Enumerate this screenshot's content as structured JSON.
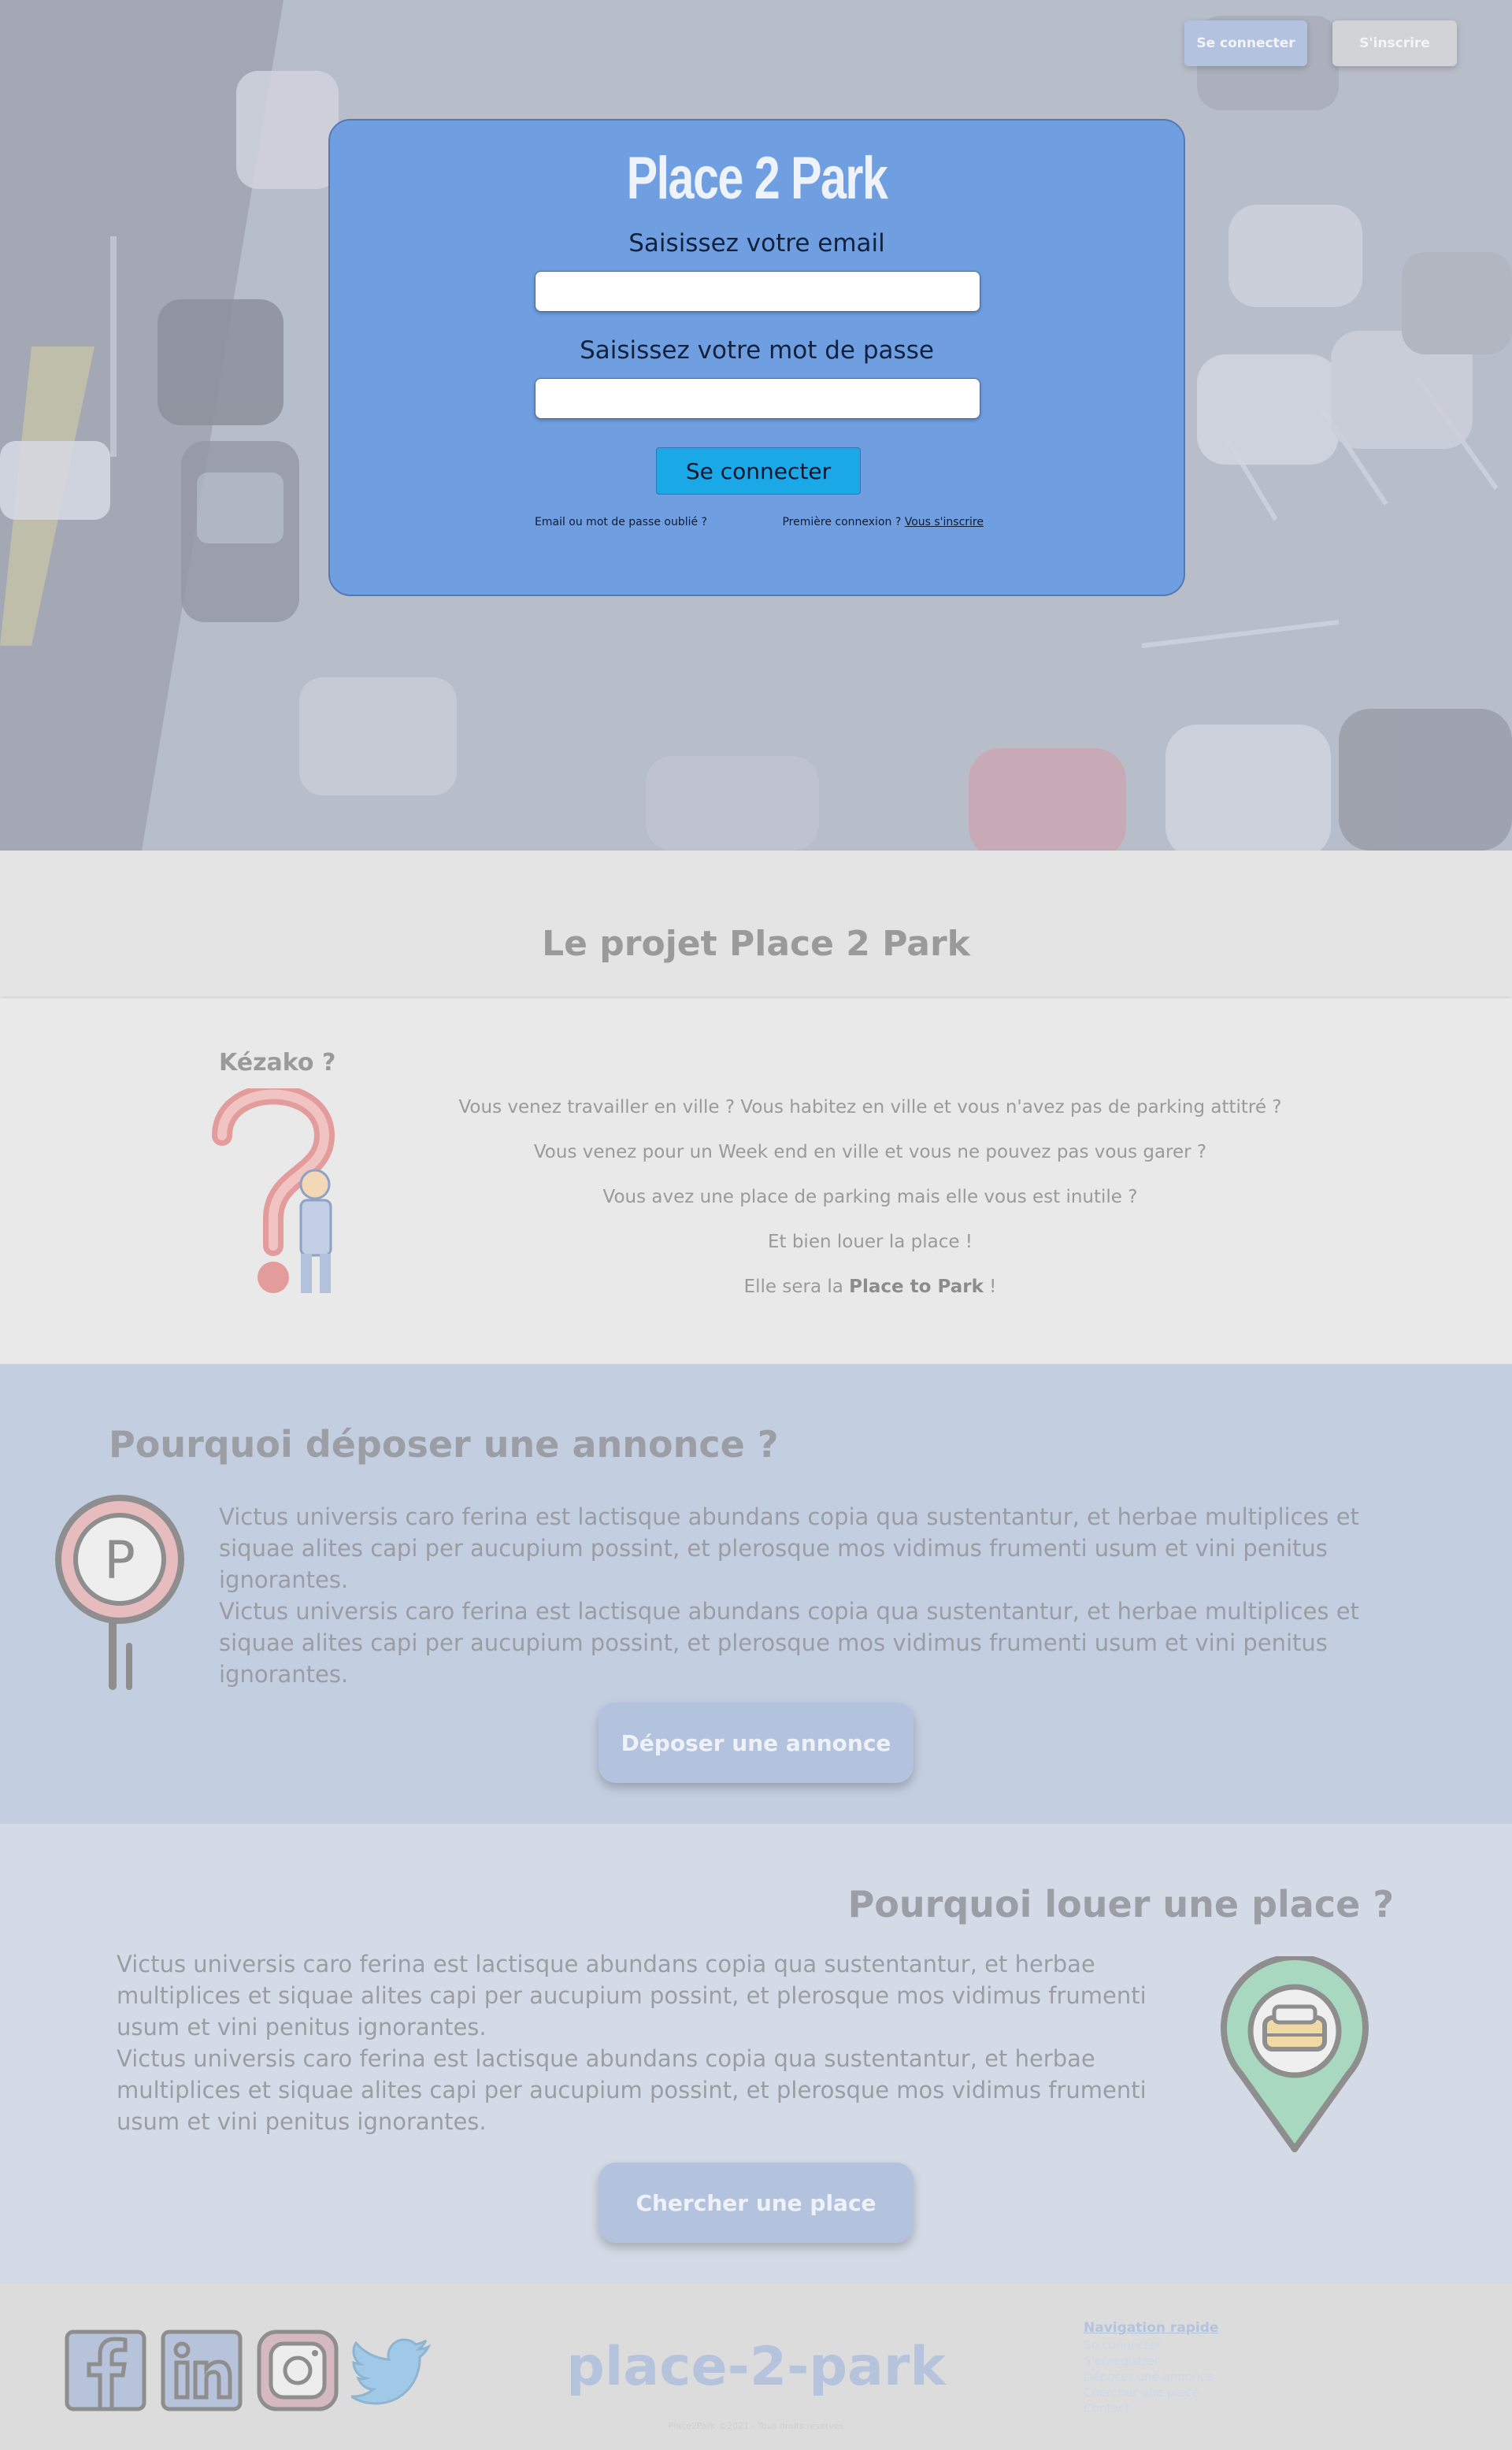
{
  "hero": {
    "top_buttons": {
      "login": "Se connecter",
      "register": "S'inscrire"
    },
    "brand": "Place 2 Park",
    "email_label": "Saisissez votre email",
    "email_value": "",
    "password_label": "Saisissez votre mot de passe",
    "password_value": "",
    "submit_label": "Se connecter",
    "forgot": "Email ou mot de passe oublié ?",
    "first_login": "Première connexion ?",
    "register_link": "Vous s'inscrire"
  },
  "projet": {
    "title": "Le projet Place 2 Park",
    "kezako_title": "Kézako ?",
    "lines": [
      "Vous venez travailler en ville ? Vous habitez en ville et vous n'avez pas de parking attitré ?",
      "Vous venez pour un Week end en ville et vous ne pouvez pas vous garer ?",
      "Vous avez une place de parking mais elle vous est inutile ?",
      "Et bien louer la place !"
    ],
    "last_line_prefix": "Elle sera la",
    "last_line_strong": "Place to Park",
    "last_line_suffix": "!"
  },
  "deposer": {
    "title": "Pourquoi déposer une annonce ?",
    "paragraph_1": "Victus universis caro ferina est lactisque abundans copia qua sustentantur, et herbae multiplices et siquae alites capi per aucupium possint, et plerosque mos vidimus frumenti usum et vini penitus ignorantes.",
    "paragraph_2": "Victus universis caro ferina est lactisque abundans copia qua sustentantur, et herbae multiplices et siquae alites capi per aucupium possint, et plerosque mos vidimus frumenti usum et vini penitus ignorantes.",
    "button": "Déposer une annonce"
  },
  "louer": {
    "title": "Pourquoi louer une place ?",
    "paragraph_1": "Victus universis caro ferina est lactisque abundans copia qua sustentantur, et herbae multiplices et siquae alites capi per aucupium possint, et plerosque mos vidimus frumenti usum et vini penitus ignorantes.",
    "paragraph_2": "Victus universis caro ferina est lactisque abundans copia qua sustentantur, et herbae multiplices et siquae alites capi per aucupium possint, et plerosque mos vidimus frumenti usum et vini penitus ignorantes.",
    "button": "Chercher une place"
  },
  "footer": {
    "brand": "place-2-park",
    "copyright": "Place2Park ©2021 - Tous droits réservés",
    "social": [
      "facebook-icon",
      "linkedin-icon",
      "instagram-icon",
      "twitter-icon"
    ],
    "nav_title": "Navigation rapide",
    "nav_items": [
      "Se connecter",
      "S'enregistrer",
      "Déposer une annonce",
      "Chercher une place",
      "Contact"
    ]
  },
  "colors": {
    "card_blue": "#709fe1",
    "submit_blue": "#1ba8e6",
    "section_blue": "#c3cee0",
    "muted_text": "#9a9a9a"
  }
}
